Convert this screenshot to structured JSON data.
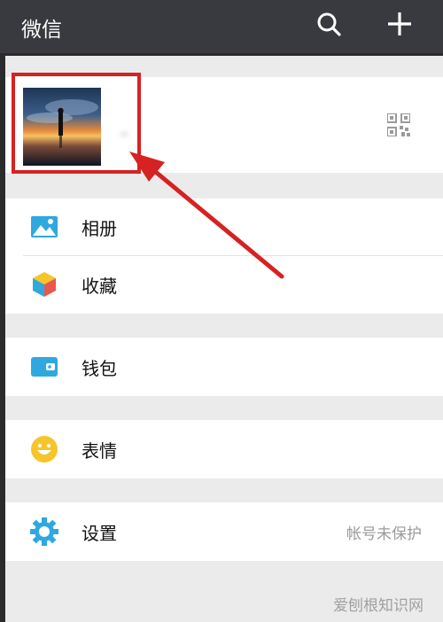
{
  "header": {
    "title": "微信",
    "search_icon": "search-icon",
    "add_icon": "plus-icon",
    "background": "#393a3f"
  },
  "profile": {
    "name": "_",
    "avatar_icon": "sunset-silhouette-avatar",
    "qr_icon": "qr-code-icon"
  },
  "menu": {
    "album": {
      "label": "相册",
      "icon": "album-icon",
      "color": "#2fa8e0"
    },
    "favorites": {
      "label": "收藏",
      "icon": "cube-favorites-icon"
    },
    "wallet": {
      "label": "钱包",
      "icon": "wallet-icon",
      "color": "#2fa8e0"
    },
    "stickers": {
      "label": "表情",
      "icon": "smiley-icon",
      "color": "#f6c52a"
    },
    "settings": {
      "label": "设置",
      "icon": "gear-icon",
      "color": "#2fa8e0",
      "hint": "帐号未保护"
    }
  },
  "annotation": {
    "color": "#d62222"
  },
  "watermark": "爱刨根知识网"
}
